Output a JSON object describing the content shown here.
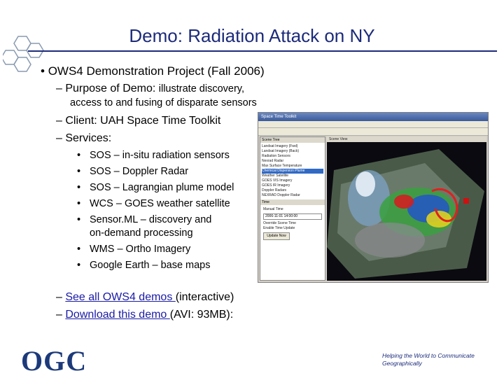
{
  "slide": {
    "title": "Demo: Radiation Attack on NY",
    "bullet": "OWS4 Demonstration Project (Fall 2006)",
    "bullet_marker": "•",
    "dash": "–",
    "purpose_label": "Purpose of Demo:",
    "purpose_text": "illustrate discovery,",
    "purpose_text2": "access to and fusing of disparate sensors",
    "client": "Client: UAH Space Time Toolkit",
    "services_label": "Services:",
    "services": [
      "SOS – in-situ radiation sensors",
      "SOS – Doppler Radar",
      "SOS – Lagrangian plume model",
      "WCS – GOES weather satellite",
      "Sensor.ML – discovery and"
    ],
    "services_cont": "on-demand processing",
    "services_more": [
      "WMS – Ortho Imagery",
      "Google Earth – base maps"
    ],
    "link1_text": "See all OWS4 demos ",
    "link1_suffix": "(interactive)",
    "link2_text": "Download this demo ",
    "link2_suffix": "(AVI: 93MB):",
    "logo_text": "OGC",
    "tagline": "Helping the World to Communicate Geographically"
  },
  "screenshot": {
    "window_title": "Space Time Toolkit",
    "left_panel_tab": "Scene Tree",
    "view_tab": "Scene View",
    "tree_items": [
      "Landsat Imagery (Fwd)",
      "Landsat Imagery (Back)",
      "Radiation Sensors",
      "Nexrad Radar",
      "Max Surface Temperature",
      "Chemical Dispersion Plume",
      "Weather Satellite",
      "GOES VIS Imagery",
      "GOES IR Imagery",
      "Doppler Radars",
      "NEXRAD Doppler Radar"
    ],
    "selected_index": 5,
    "lower_panel_tab": "Time",
    "manual_time_label": "Manual Time",
    "time_value": "2006-11-01 14:00:00",
    "checkbox1": "Override Scene Time",
    "checkbox2": "Enable Time Update",
    "button_label": "Update Now"
  },
  "colors": {
    "title": "#1c2b7a",
    "link": "#1a1aa6",
    "logo": "#1c3a7a"
  }
}
